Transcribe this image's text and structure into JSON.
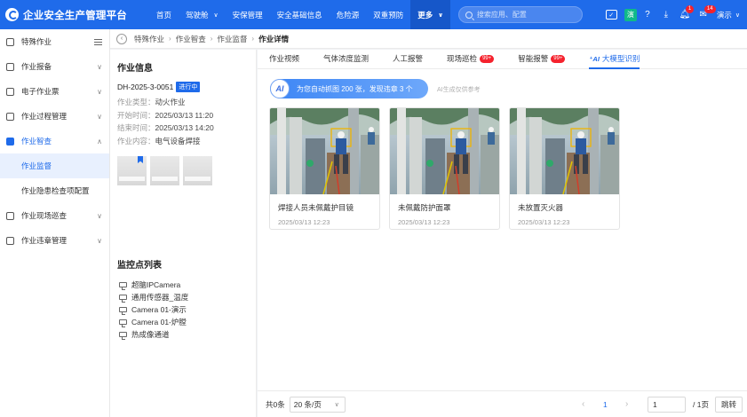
{
  "app": {
    "title": "企业安全生产管理平台"
  },
  "nav": {
    "items": [
      {
        "label": "首页",
        "chevron": false
      },
      {
        "label": "驾驶舱",
        "chevron": true
      },
      {
        "label": "安保管理",
        "chevron": false
      },
      {
        "label": "安全基础信息",
        "chevron": false
      },
      {
        "label": "危险源",
        "chevron": false
      },
      {
        "label": "双重预防",
        "chevron": false
      },
      {
        "label": "更多",
        "chevron": true
      }
    ]
  },
  "search": {
    "placeholder": "搜索应用、配置"
  },
  "header_tools": {
    "notify_badge": "1",
    "message_badge": "14",
    "avatar_text": "演",
    "user_name": "演示"
  },
  "sidebar": {
    "items": [
      {
        "label": "特殊作业",
        "kind": "top",
        "right": "collapse"
      },
      {
        "label": "作业报备",
        "kind": "group",
        "chev": "∨"
      },
      {
        "label": "电子作业票",
        "kind": "group",
        "chev": "∨"
      },
      {
        "label": "作业过程管理",
        "kind": "group",
        "chev": "∨"
      },
      {
        "label": "作业智查",
        "kind": "group-open",
        "chev": "∧"
      },
      {
        "label": "作业监督",
        "kind": "sub-active"
      },
      {
        "label": "作业隐患检查项配置",
        "kind": "sub"
      },
      {
        "label": "作业现场巡查",
        "kind": "group",
        "chev": "∨"
      },
      {
        "label": "作业违章管理",
        "kind": "group",
        "chev": "∨"
      }
    ]
  },
  "breadcrumb": [
    "特殊作业",
    "作业智查",
    "作业监督",
    "作业详情"
  ],
  "info": {
    "title": "作业信息",
    "job_no": "DH-2025-3-0051",
    "status": "进行中",
    "fields": [
      {
        "label": "作业类型：",
        "value": "动火作业"
      },
      {
        "label": "开始时间：",
        "value": "2025/03/13 11:20"
      },
      {
        "label": "结束时间：",
        "value": "2025/03/13 14:20"
      },
      {
        "label": "作业内容：",
        "value": "电气设备焊接"
      }
    ]
  },
  "monitor": {
    "title": "监控点列表",
    "items": [
      "超脑IPCamera",
      "通用传感器_温度",
      "Camera 01-演示",
      "Camera 01-炉膛",
      "热成像通道"
    ]
  },
  "tabs": [
    {
      "label": "作业视频",
      "badge": ""
    },
    {
      "label": "气体浓度监测",
      "badge": ""
    },
    {
      "label": "人工报警",
      "badge": ""
    },
    {
      "label": "现场巡检",
      "badge": "99+"
    },
    {
      "label": "智能报警",
      "badge": "99+"
    },
    {
      "label": "大模型识别",
      "badge": "",
      "active": true
    }
  ],
  "ai": {
    "logo": "AI",
    "banner_text": "为您自动抓图 200 张，发现违章 3 个",
    "hint": "AI生成仅供参考"
  },
  "cards": [
    {
      "title": "焊接人员未佩戴护目镜",
      "time": "2025/03/13 12:23"
    },
    {
      "title": "未佩戴防护面罩",
      "time": "2025/03/13 12:23"
    },
    {
      "title": "未放置灭火器",
      "time": "2025/03/13 12:23"
    }
  ],
  "pagination": {
    "total": "共0条",
    "page_size": "20 条/页",
    "current": "1",
    "jump_value": "1",
    "page_total": "/ 1页",
    "jump_label": "跳转"
  },
  "colors": {
    "primary": "#1f6bea",
    "badge": "#f5222d"
  }
}
